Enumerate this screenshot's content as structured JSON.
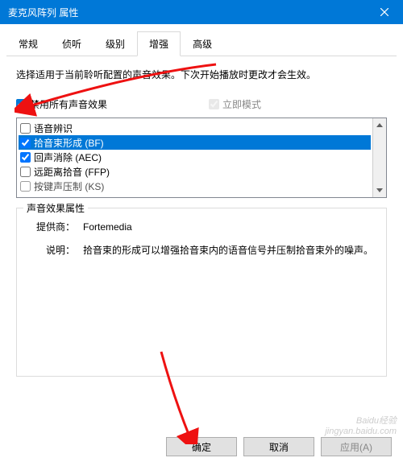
{
  "title": "麦克风阵列 属性",
  "tabs": {
    "general": "常规",
    "listen": "侦听",
    "levels": "级别",
    "enhance": "增强",
    "advanced": "高级"
  },
  "description": "选择适用于当前聆听配置的声音效果。下次开始播放时更改才会生效。",
  "disable_all_label": "禁用所有声音效果",
  "immediate_label": "立即模式",
  "list": {
    "item0": "语音辨识",
    "item1": "拾音束形成 (BF)",
    "item2": "回声消除 (AEC)",
    "item3": "远距离拾音 (FFP)",
    "item4": "按键声压制 (KS)"
  },
  "group_title": "声音效果属性",
  "provider_label": "提供商：",
  "provider_value": "Fortemedia",
  "desc_label": "说明：",
  "desc_value": "拾音束的形成可以增强拾音束内的语音信号并压制拾音束外的噪声。",
  "buttons": {
    "ok": "确定",
    "cancel": "取消",
    "apply": "应用(A)"
  },
  "watermark": {
    "line1": "Baidu经验",
    "line2": "jingyan.baidu.com"
  }
}
